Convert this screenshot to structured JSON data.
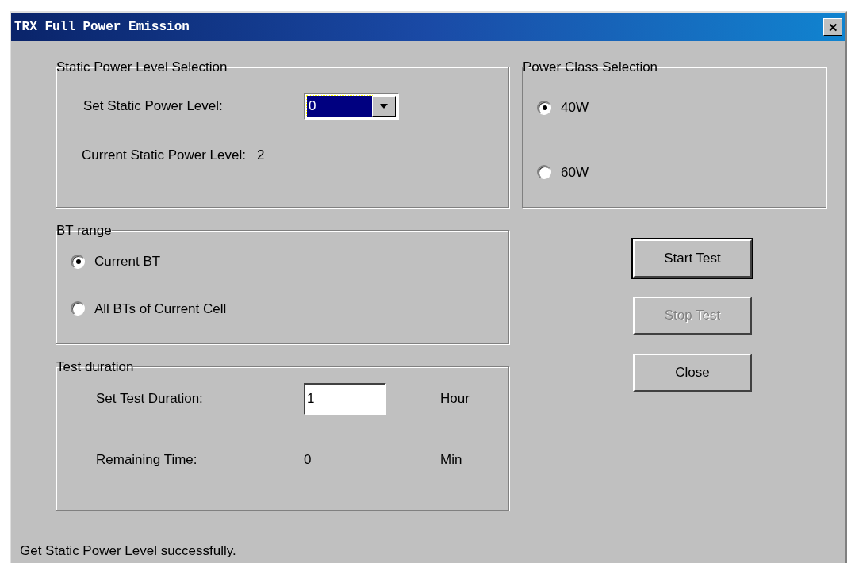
{
  "window": {
    "title": "TRX Full Power Emission",
    "close": "✕"
  },
  "static_power": {
    "title": "Static Power Level Selection",
    "set_label": "Set Static Power Level:",
    "set_value": "0",
    "current_label": "Current Static Power Level:",
    "current_value": "2"
  },
  "power_class": {
    "title": "Power Class Selection",
    "options": [
      {
        "label": "40W",
        "selected": true
      },
      {
        "label": "60W",
        "selected": false
      }
    ]
  },
  "bt_range": {
    "title": "BT range",
    "options": [
      {
        "label": "Current BT",
        "selected": true
      },
      {
        "label": "All BTs of Current Cell",
        "selected": false
      }
    ]
  },
  "test_duration": {
    "title": "Test duration",
    "set_label": "Set Test Duration:",
    "set_value": "1",
    "set_unit": "Hour",
    "remaining_label": "Remaining Time:",
    "remaining_value": "0",
    "remaining_unit": "Min"
  },
  "buttons": [
    {
      "label": "Start Test",
      "disabled": false,
      "default": true
    },
    {
      "label": "Stop Test",
      "disabled": true,
      "default": false
    },
    {
      "label": "Close",
      "disabled": false,
      "default": false
    }
  ],
  "status_bar": "Get Static Power Level successfully."
}
